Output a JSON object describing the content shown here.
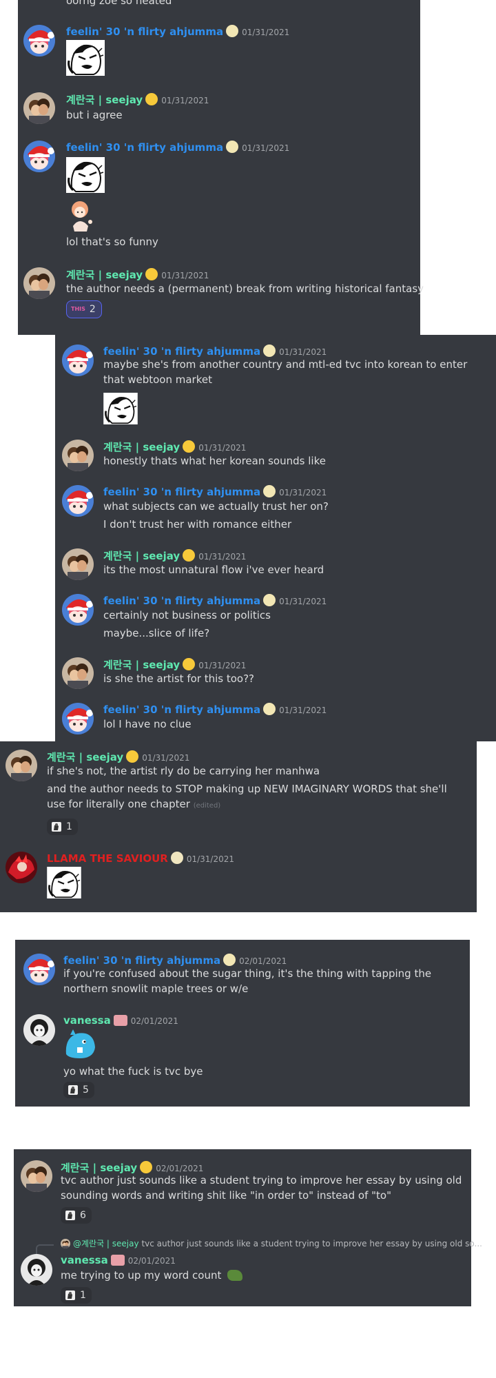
{
  "panel1": {
    "top_text": "oorng zoe so heated",
    "m1": {
      "name": "feelin' 30 'n flirty ahjumma",
      "ts": "01/31/2021"
    },
    "m2": {
      "name": "계란국 | seejay",
      "ts": "01/31/2021",
      "text": "but i agree"
    },
    "m3": {
      "name": "feelin' 30 'n flirty ahjumma",
      "ts": "01/31/2021",
      "text": "lol that's so funny"
    },
    "m4": {
      "name": "계란국 | seejay",
      "ts": "01/31/2021",
      "text": "the author needs a (permanent) break from writing historical fantasy",
      "reaction_label": "THIS",
      "reaction_count": "2"
    }
  },
  "panel2": {
    "m1": {
      "name": "feelin' 30 'n flirty ahjumma",
      "ts": "01/31/2021",
      "text": "maybe she's from another country and mtl-ed tvc into korean to enter that webtoon market"
    },
    "m2": {
      "name": "계란국 | seejay",
      "ts": "01/31/2021",
      "text": "honestly thats what her korean sounds like"
    },
    "m3": {
      "name": "feelin' 30 'n flirty ahjumma",
      "ts": "01/31/2021",
      "text1": "what subjects can we actually trust her on?",
      "text2": "I don't trust her with romance either"
    },
    "m4": {
      "name": "계란국 | seejay",
      "ts": "01/31/2021",
      "text": "its the most unnatural flow i've ever heard"
    },
    "m5": {
      "name": "feelin' 30 'n flirty ahjumma",
      "ts": "01/31/2021",
      "text1": "certainly not business or politics",
      "text2": "maybe...slice of life?"
    },
    "m6": {
      "name": "계란국 | seejay",
      "ts": "01/31/2021",
      "text": "is she the artist for this too??"
    },
    "m7": {
      "name": "feelin' 30 'n flirty ahjumma",
      "ts": "01/31/2021",
      "text": "lol I have no clue"
    }
  },
  "panel3": {
    "m1": {
      "name": "계란국 | seejay",
      "ts": "01/31/2021",
      "text1": "if she's not, the artist rly do be carrying her manhwa",
      "text2": "and the author needs to STOP making up NEW IMAGINARY WORDS that she'll use for literally one chapter",
      "edited": "(edited)",
      "reaction_count": "1"
    },
    "m2": {
      "name": "LLAMA THE SAVIOUR",
      "ts": "01/31/2021"
    }
  },
  "panel4": {
    "m1": {
      "name": "feelin' 30 'n flirty ahjumma",
      "ts": "02/01/2021",
      "text": "if you're confused about the sugar thing, it's the thing with tapping the northern snowlit maple trees or w/e"
    },
    "m2": {
      "name": "vanessa",
      "ts": "02/01/2021",
      "text": "yo what the fuck is tvc bye",
      "reaction_count": "5"
    }
  },
  "panel5": {
    "m1": {
      "name": "계란국 | seejay",
      "ts": "02/01/2021",
      "text": "tvc author just sounds like a student trying to improve her essay by using old sounding words and writing shit like \"in order to\" instead of \"to\"",
      "reaction_count": "6"
    },
    "reply": {
      "mention": "@계란국 | seejay",
      "preview": "tvc author just sounds like a student trying to improve her essay by using old so..."
    },
    "m2": {
      "name": "vanessa",
      "ts": "02/01/2021",
      "text": "me trying to up my word count",
      "reaction_count": "1"
    }
  },
  "colors": {
    "panel_bg": "#36393f",
    "name_blue": "#2f8ff0",
    "name_green": "#5fe8b0",
    "name_red": "#e02020",
    "timestamp": "#a3a6aa"
  }
}
